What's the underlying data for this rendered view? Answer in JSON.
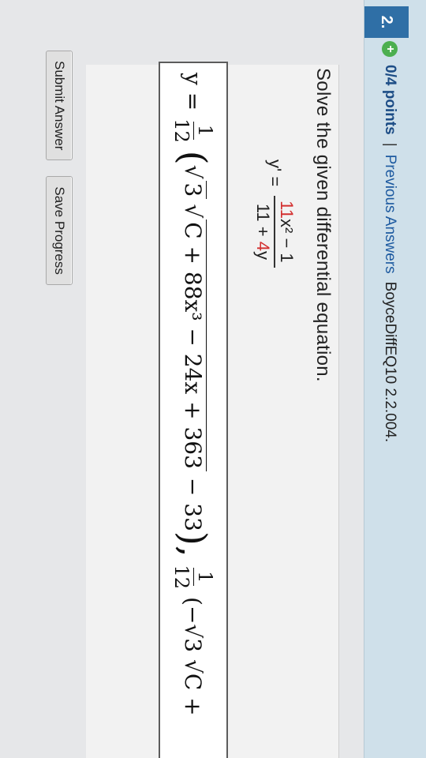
{
  "question": {
    "number": "2.",
    "points": "0/4 points",
    "separator": "|",
    "previous_answers_link": "Previous Answers",
    "source": "BoyceDiffEQ10 2.2.004."
  },
  "prompt": "Solve the given differential equation.",
  "equation": {
    "lhs": "y' =",
    "numerator_red": "11",
    "numerator_rest": "x² − 1",
    "denominator_plain": "11 + ",
    "denominator_red": "4",
    "denominator_rest": "y"
  },
  "answer_field": {
    "prefix": "y =",
    "coef_num": "1",
    "coef_den": "12",
    "radicand_outer": "3",
    "radicand_inner": "C + 88x³ − 24x + 363",
    "after_sqrt": "− 33",
    "sep": "),",
    "second_coef_num": "1",
    "second_coef_den": "12",
    "second_part": "(−√3 √C +"
  },
  "buttons": {
    "submit": "Submit Answer",
    "save": "Save Progress"
  },
  "colors": {
    "accent": "#2f6fa6",
    "header_bg": "#cfe0ea",
    "highlight_red": "#d32f2f"
  }
}
